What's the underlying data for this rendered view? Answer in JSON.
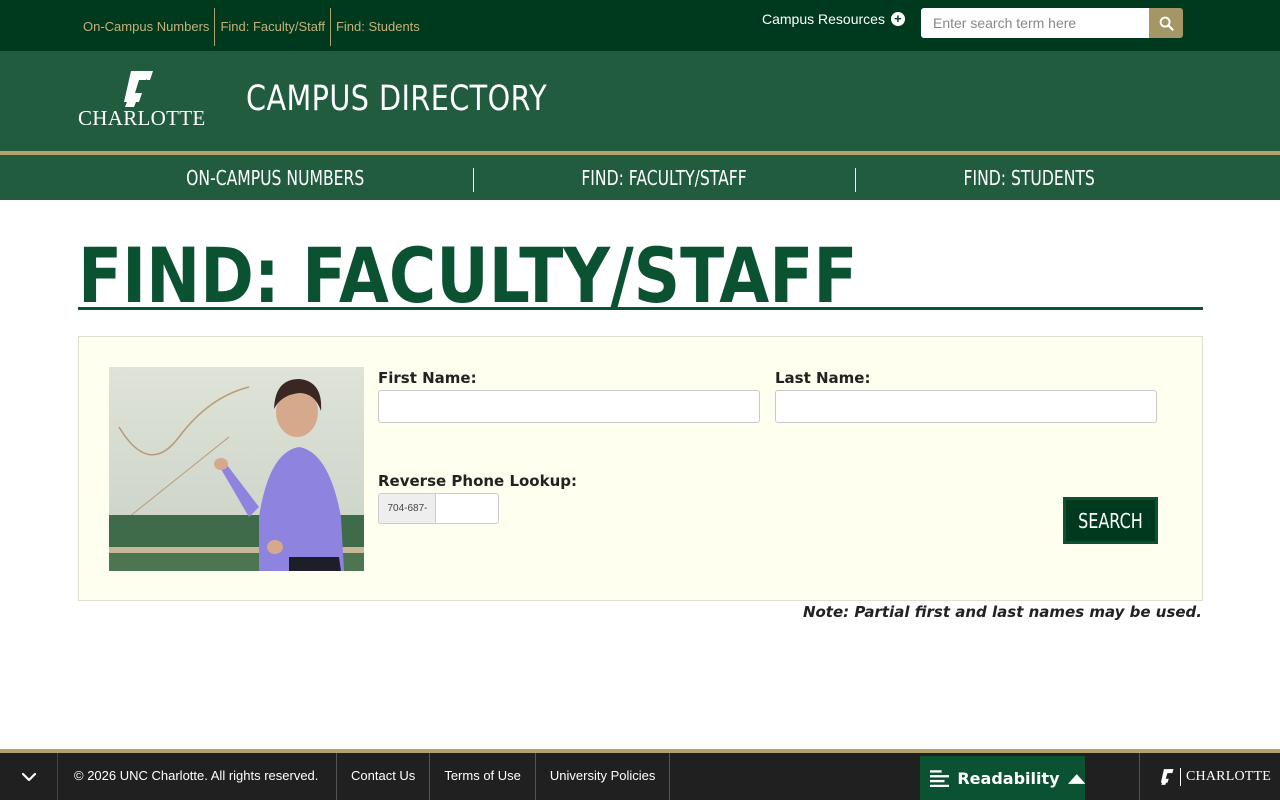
{
  "utility": {
    "links": [
      {
        "label": "On-Campus Numbers"
      },
      {
        "label": "Find: Faculty/Staff"
      },
      {
        "label": "Find: Students"
      }
    ],
    "campus_resources": "Campus Resources",
    "search_placeholder": "Enter search term here"
  },
  "header": {
    "logo_text": "CHARLOTTE",
    "site_title": "CAMPUS DIRECTORY"
  },
  "mainnav": {
    "items": [
      {
        "label": "ON-CAMPUS NUMBERS"
      },
      {
        "label": "FIND: FACULTY/STAFF"
      },
      {
        "label": "FIND: STUDENTS"
      }
    ]
  },
  "page": {
    "title": "FIND: FACULTY/STAFF"
  },
  "form": {
    "first_name_label": "First Name:",
    "first_name_value": "",
    "last_name_label": "Last Name:",
    "last_name_value": "",
    "reverse_phone_label": "Reverse Phone Lookup:",
    "phone_prefix": "704-687-",
    "phone_value": "",
    "search_label": "SEARCH"
  },
  "note": "Note: Partial first and last names may be used.",
  "footer": {
    "copyright": "© 2026 UNC Charlotte. All rights reserved.",
    "links": [
      {
        "label": "Contact Us"
      },
      {
        "label": "Terms of Use"
      },
      {
        "label": "University Policies"
      }
    ],
    "readability_label": "Readability",
    "logo_text": "CHARLOTTE"
  },
  "colors": {
    "brand_dark": "#003a1e",
    "brand_green": "#215c3f",
    "gold": "#b3a36b",
    "heading_green": "#0b5233",
    "panel_bg": "#fffff0"
  }
}
